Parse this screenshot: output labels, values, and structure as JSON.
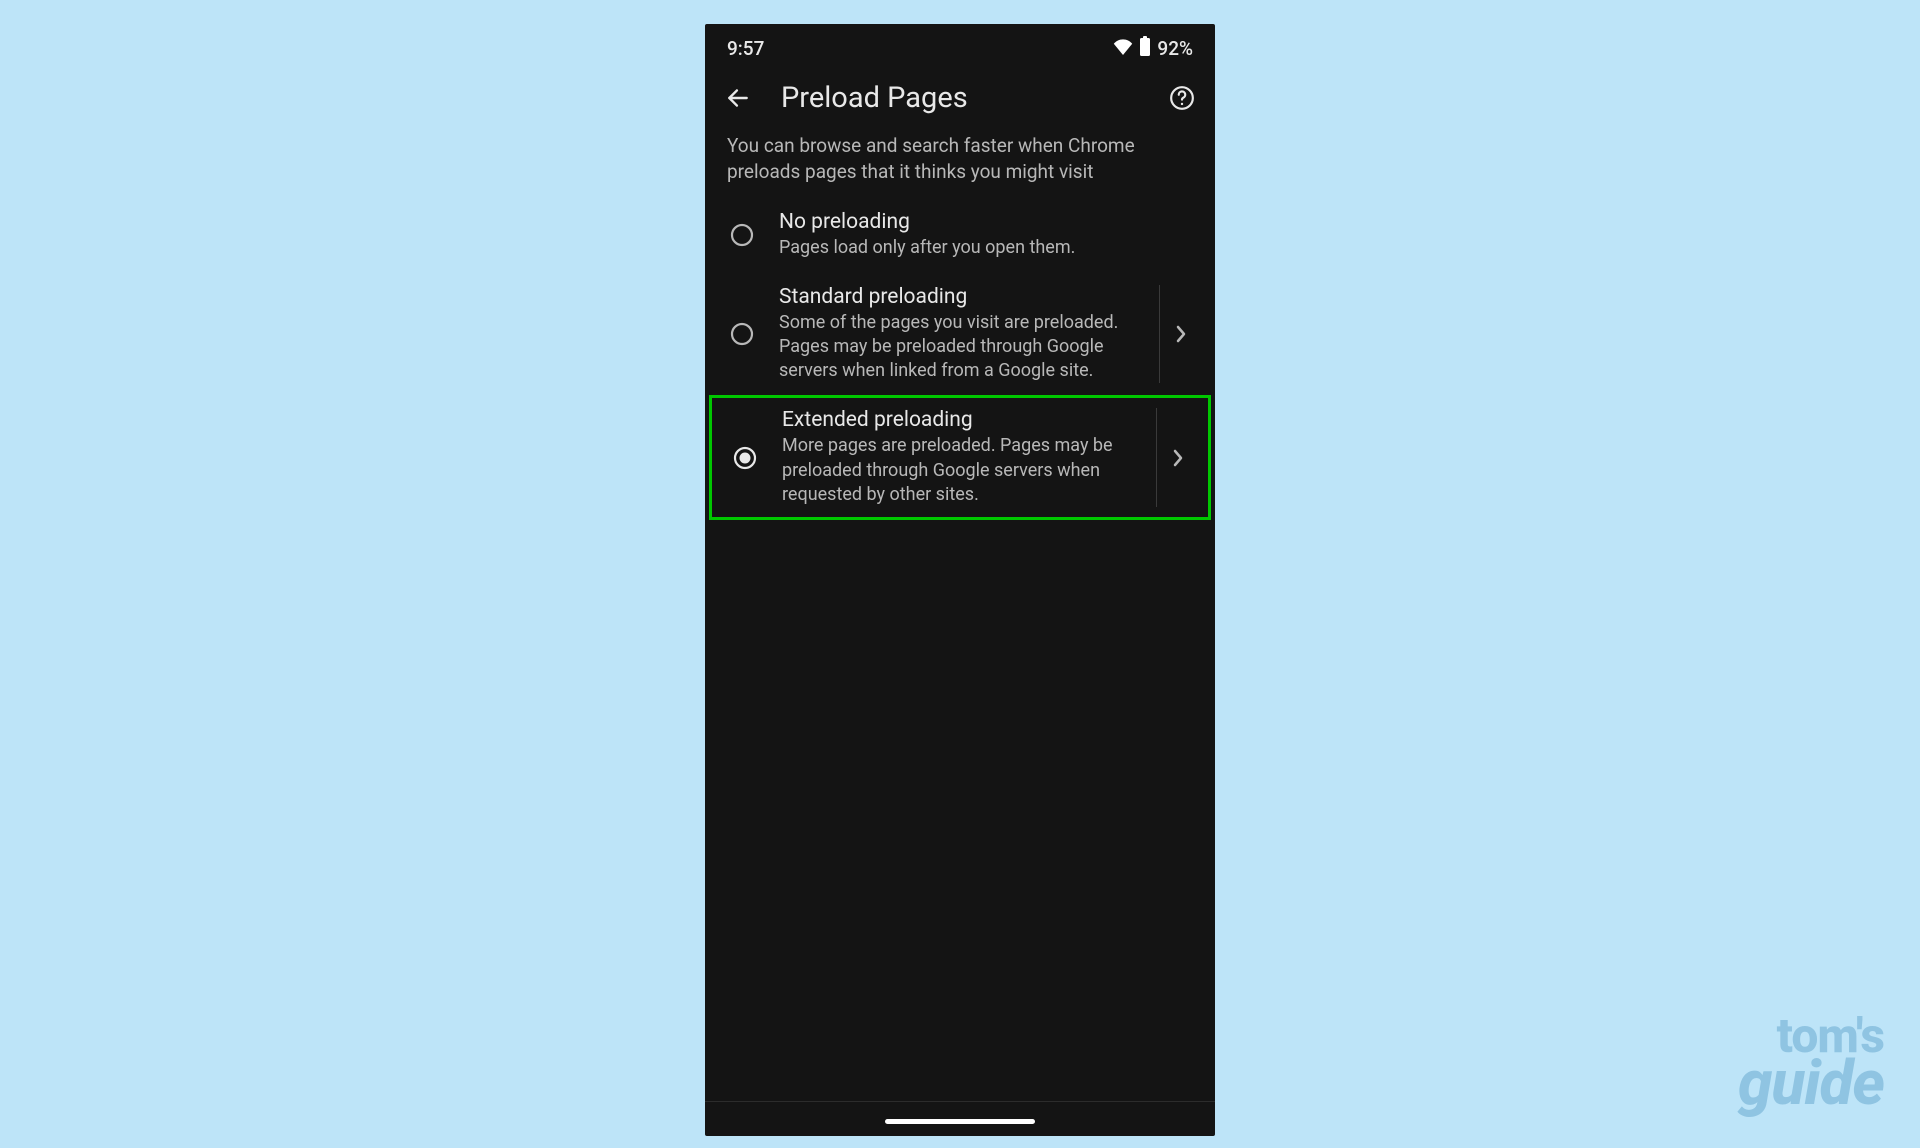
{
  "status_bar": {
    "time": "9:57",
    "battery_percent": "92%"
  },
  "header": {
    "title": "Preload Pages"
  },
  "intro_text": "You can browse and search faster when Chrome preloads pages that it thinks you might visit",
  "options": [
    {
      "label": "No preloading",
      "description": "Pages load only after you open them.",
      "selected": false,
      "has_chevron": false,
      "highlighted": false
    },
    {
      "label": "Standard preloading",
      "description": "Some of the pages you visit are preloaded. Pages may be preloaded through Google servers when linked from a Google site.",
      "selected": false,
      "has_chevron": true,
      "highlighted": false
    },
    {
      "label": "Extended preloading",
      "description": "More pages are preloaded. Pages may be preloaded through Google servers when requested by other sites.",
      "selected": true,
      "has_chevron": true,
      "highlighted": true
    }
  ],
  "watermark": {
    "line1": "tom's",
    "line2": "guide"
  }
}
